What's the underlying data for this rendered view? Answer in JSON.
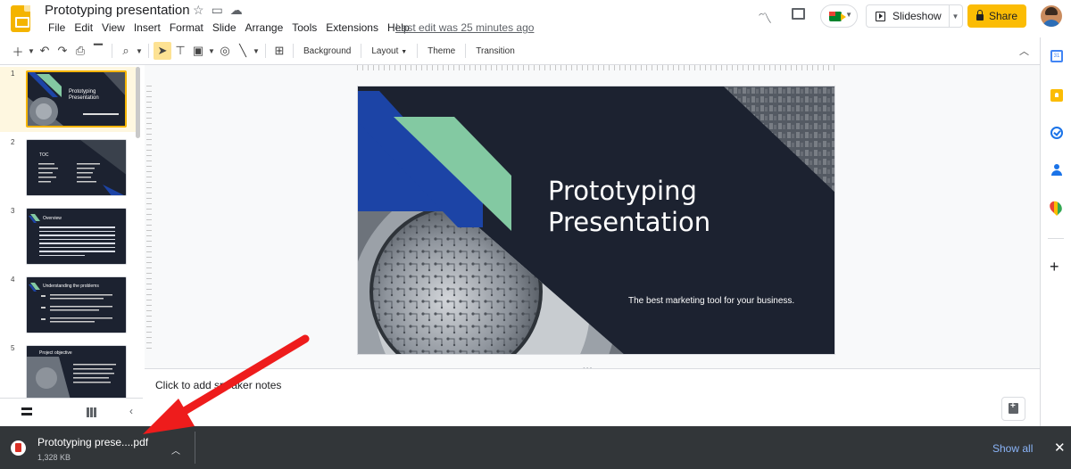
{
  "header": {
    "doc_title": "Prototyping presentation",
    "menu": [
      "File",
      "Edit",
      "View",
      "Insert",
      "Format",
      "Slide",
      "Arrange",
      "Tools",
      "Extensions",
      "Help"
    ],
    "last_edit": "Last edit was 25 minutes ago",
    "slideshow_label": "Slideshow",
    "share_label": "Share"
  },
  "toolbar": {
    "background_label": "Background",
    "layout_label": "Layout",
    "theme_label": "Theme",
    "transition_label": "Transition"
  },
  "filmstrip": {
    "slides": [
      {
        "number": "1",
        "title": "Prototyping Presentation"
      },
      {
        "number": "2",
        "title": "TOC"
      },
      {
        "number": "3",
        "title": "Overview"
      },
      {
        "number": "4",
        "title": "Understanding the problems"
      },
      {
        "number": "5",
        "title": "Project objective"
      }
    ]
  },
  "slide": {
    "title_line1": "Prototyping",
    "title_line2": "Presentation",
    "subtitle": "The best marketing tool for your business.",
    "accent_green": "#83c9a2",
    "accent_blue": "#1c44a6",
    "background": "#1c2230"
  },
  "notes": {
    "placeholder": "Click to add speaker notes"
  },
  "download": {
    "file_name": "Prototyping prese....pdf",
    "file_size": "1,328 KB",
    "show_all": "Show all"
  },
  "side_panel": {
    "calendar_day": "31"
  }
}
